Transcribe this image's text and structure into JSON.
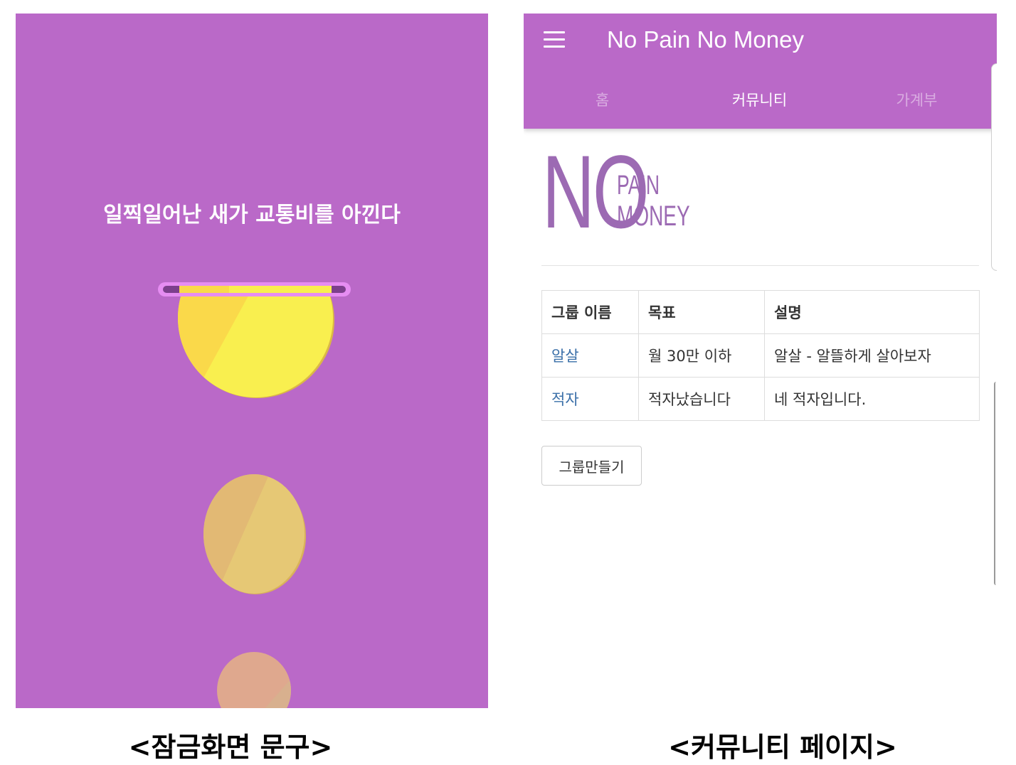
{
  "lock_screen": {
    "phrase": "일찍일어난 새가 교통비를 아낀다",
    "coin_icon": "coin-slot-icon",
    "colors": {
      "background": "#ba69c8",
      "coin_front": "#f9ef4f",
      "coin_shade": "#fad94a",
      "slot": "#e68df2"
    }
  },
  "app": {
    "title": "No Pain No Money",
    "menu_icon": "hamburger-menu-icon",
    "tabs": [
      {
        "label": "홈",
        "active": false
      },
      {
        "label": "커뮤니티",
        "active": true
      },
      {
        "label": "가계부",
        "active": false
      }
    ],
    "logo": {
      "big": "NO",
      "line1": "PAIN",
      "line2": "MONEY"
    },
    "table": {
      "headers": [
        "그룹 이름",
        "목표",
        "설명"
      ],
      "rows": [
        {
          "name": "알살",
          "goal": "월 30만 이하",
          "desc": "알살 - 알뜰하게 살아보자"
        },
        {
          "name": "적자",
          "goal": "적자났습니다",
          "desc": "네 적자입니다."
        }
      ]
    },
    "create_button": "그룹만들기",
    "colors": {
      "appbar": "#ba69c8",
      "link": "#3a6fa8",
      "logo": "#9c6ab3"
    }
  },
  "captions": {
    "left": "<잠금화면 문구>",
    "right": "<커뮤니티 페이지>"
  }
}
